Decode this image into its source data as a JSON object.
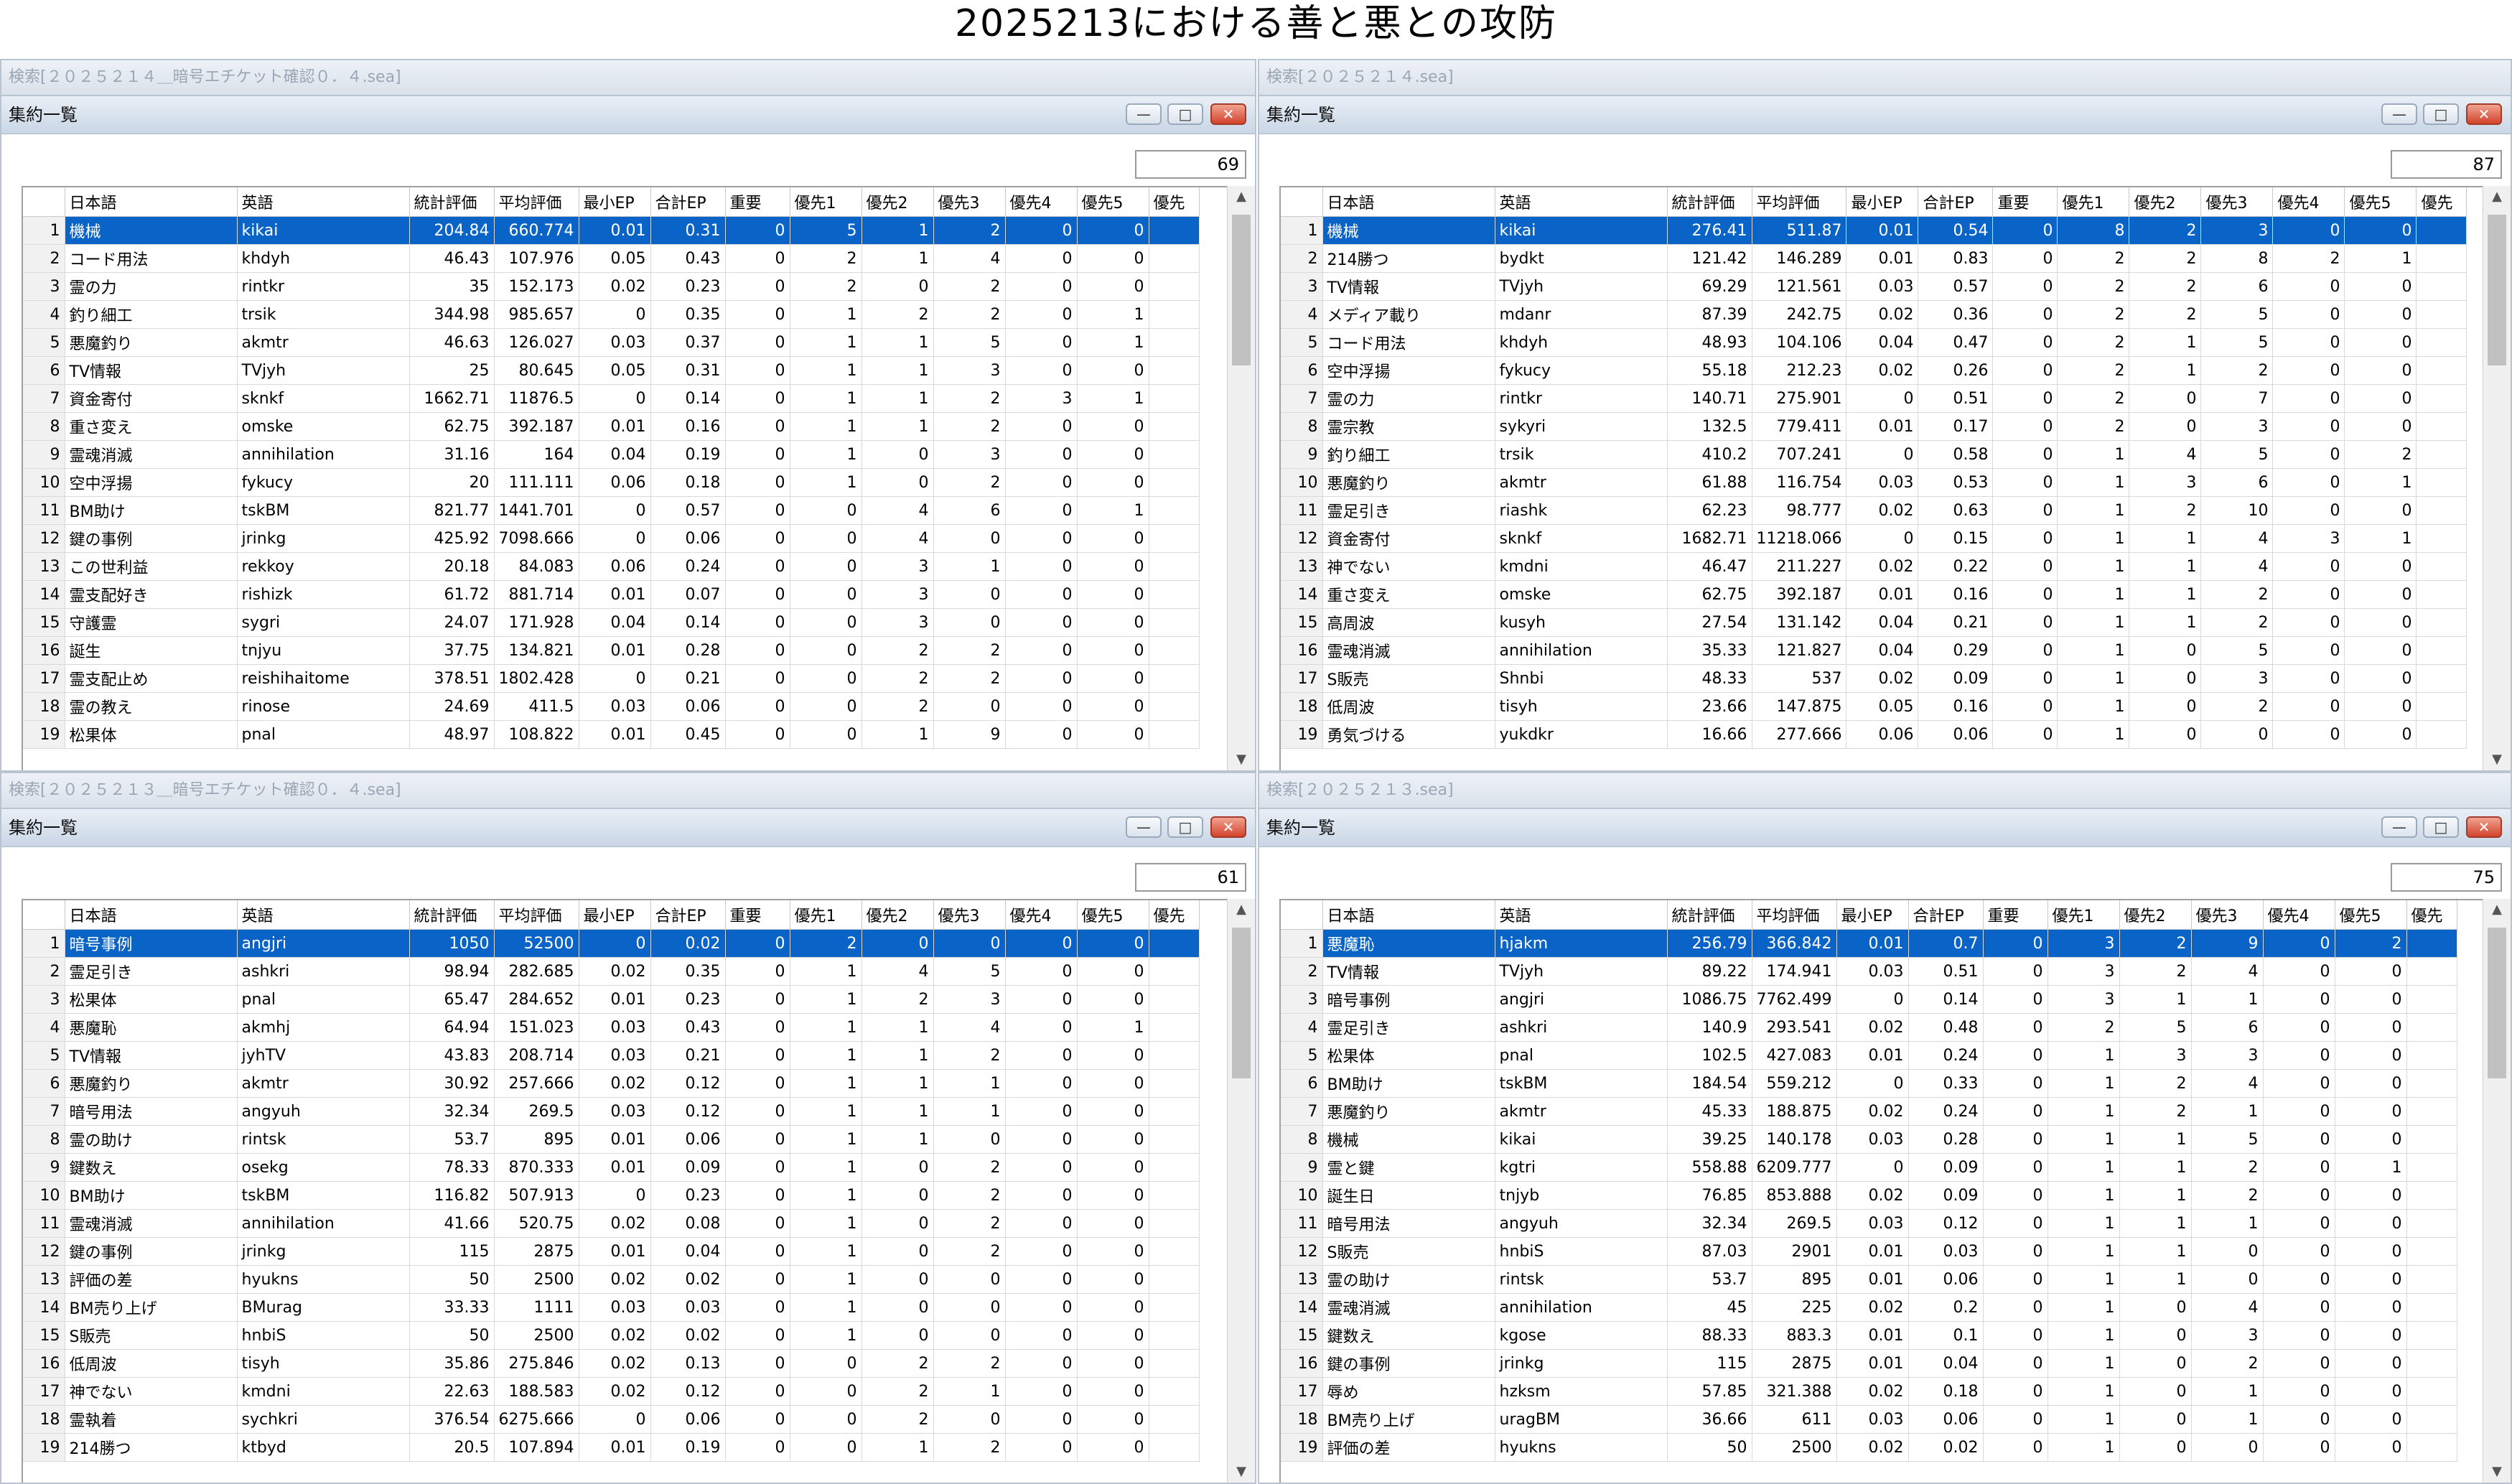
{
  "title": "2025213における善と悪との攻防",
  "columns": [
    "日本語",
    "英語",
    "統計評価",
    "平均評価",
    "最小EP",
    "合計EP",
    "重要",
    "優先1",
    "優先2",
    "優先3",
    "優先4",
    "優先5",
    "優先"
  ],
  "panes": [
    {
      "search": "検索[２０２５２１４＿暗号エチケット確認０．４.sea]",
      "window_title": "集約一覧",
      "count": "69",
      "rows": [
        [
          "1",
          "機械",
          "kikai",
          "204.84",
          "660.774",
          "0.01",
          "0.31",
          "0",
          "5",
          "1",
          "2",
          "0",
          "0"
        ],
        [
          "2",
          "コード用法",
          "khdyh",
          "46.43",
          "107.976",
          "0.05",
          "0.43",
          "0",
          "2",
          "1",
          "4",
          "0",
          "0"
        ],
        [
          "3",
          "霊の力",
          "rintkr",
          "35",
          "152.173",
          "0.02",
          "0.23",
          "0",
          "2",
          "0",
          "2",
          "0",
          "0"
        ],
        [
          "4",
          "釣り細工",
          "trsik",
          "344.98",
          "985.657",
          "0",
          "0.35",
          "0",
          "1",
          "2",
          "2",
          "0",
          "1"
        ],
        [
          "5",
          "悪魔釣り",
          "akmtr",
          "46.63",
          "126.027",
          "0.03",
          "0.37",
          "0",
          "1",
          "1",
          "5",
          "0",
          "1"
        ],
        [
          "6",
          "TV情報",
          "TVjyh",
          "25",
          "80.645",
          "0.05",
          "0.31",
          "0",
          "1",
          "1",
          "3",
          "0",
          "0"
        ],
        [
          "7",
          "資金寄付",
          "sknkf",
          "1662.71",
          "11876.5",
          "0",
          "0.14",
          "0",
          "1",
          "1",
          "2",
          "3",
          "1"
        ],
        [
          "8",
          "重さ変え",
          "omske",
          "62.75",
          "392.187",
          "0.01",
          "0.16",
          "0",
          "1",
          "1",
          "2",
          "0",
          "0"
        ],
        [
          "9",
          "霊魂消滅",
          "annihilation",
          "31.16",
          "164",
          "0.04",
          "0.19",
          "0",
          "1",
          "0",
          "3",
          "0",
          "0"
        ],
        [
          "10",
          "空中浮揚",
          "fykucy",
          "20",
          "111.111",
          "0.06",
          "0.18",
          "0",
          "1",
          "0",
          "2",
          "0",
          "0"
        ],
        [
          "11",
          "BM助け",
          "tskBM",
          "821.77",
          "1441.701",
          "0",
          "0.57",
          "0",
          "0",
          "4",
          "6",
          "0",
          "1"
        ],
        [
          "12",
          "鍵の事例",
          "jrinkg",
          "425.92",
          "7098.666",
          "0",
          "0.06",
          "0",
          "0",
          "4",
          "0",
          "0",
          "0"
        ],
        [
          "13",
          "この世利益",
          "rekkoy",
          "20.18",
          "84.083",
          "0.06",
          "0.24",
          "0",
          "0",
          "3",
          "1",
          "0",
          "0"
        ],
        [
          "14",
          "霊支配好き",
          "rishizk",
          "61.72",
          "881.714",
          "0.01",
          "0.07",
          "0",
          "0",
          "3",
          "0",
          "0",
          "0"
        ],
        [
          "15",
          "守護霊",
          "sygri",
          "24.07",
          "171.928",
          "0.04",
          "0.14",
          "0",
          "0",
          "3",
          "0",
          "0",
          "0"
        ],
        [
          "16",
          "誕生",
          "tnjyu",
          "37.75",
          "134.821",
          "0.01",
          "0.28",
          "0",
          "0",
          "2",
          "2",
          "0",
          "0"
        ],
        [
          "17",
          "霊支配止め",
          "reishihaitome",
          "378.51",
          "1802.428",
          "0",
          "0.21",
          "0",
          "0",
          "2",
          "2",
          "0",
          "0"
        ],
        [
          "18",
          "霊の教え",
          "rinose",
          "24.69",
          "411.5",
          "0.03",
          "0.06",
          "0",
          "0",
          "2",
          "0",
          "0",
          "0"
        ],
        [
          "19",
          "松果体",
          "pnal",
          "48.97",
          "108.822",
          "0.01",
          "0.45",
          "0",
          "0",
          "1",
          "9",
          "0",
          "0"
        ]
      ]
    },
    {
      "search": "検索[２０２５２１４.sea]",
      "window_title": "集約一覧",
      "count": "87",
      "rows": [
        [
          "1",
          "機械",
          "kikai",
          "276.41",
          "511.87",
          "0.01",
          "0.54",
          "0",
          "8",
          "2",
          "3",
          "0",
          "0"
        ],
        [
          "2",
          "214勝つ",
          "bydkt",
          "121.42",
          "146.289",
          "0.01",
          "0.83",
          "0",
          "2",
          "2",
          "8",
          "2",
          "1"
        ],
        [
          "3",
          "TV情報",
          "TVjyh",
          "69.29",
          "121.561",
          "0.03",
          "0.57",
          "0",
          "2",
          "2",
          "6",
          "0",
          "0"
        ],
        [
          "4",
          "メディア載り",
          "mdanr",
          "87.39",
          "242.75",
          "0.02",
          "0.36",
          "0",
          "2",
          "2",
          "5",
          "0",
          "0"
        ],
        [
          "5",
          "コード用法",
          "khdyh",
          "48.93",
          "104.106",
          "0.04",
          "0.47",
          "0",
          "2",
          "1",
          "5",
          "0",
          "0"
        ],
        [
          "6",
          "空中浮揚",
          "fykucy",
          "55.18",
          "212.23",
          "0.02",
          "0.26",
          "0",
          "2",
          "1",
          "2",
          "0",
          "0"
        ],
        [
          "7",
          "霊の力",
          "rintkr",
          "140.71",
          "275.901",
          "0",
          "0.51",
          "0",
          "2",
          "0",
          "7",
          "0",
          "0"
        ],
        [
          "8",
          "霊宗教",
          "sykyri",
          "132.5",
          "779.411",
          "0.01",
          "0.17",
          "0",
          "2",
          "0",
          "3",
          "0",
          "0"
        ],
        [
          "9",
          "釣り細工",
          "trsik",
          "410.2",
          "707.241",
          "0",
          "0.58",
          "0",
          "1",
          "4",
          "5",
          "0",
          "2"
        ],
        [
          "10",
          "悪魔釣り",
          "akmtr",
          "61.88",
          "116.754",
          "0.03",
          "0.53",
          "0",
          "1",
          "3",
          "6",
          "0",
          "1"
        ],
        [
          "11",
          "霊足引き",
          "riashk",
          "62.23",
          "98.777",
          "0.02",
          "0.63",
          "0",
          "1",
          "2",
          "10",
          "0",
          "0"
        ],
        [
          "12",
          "資金寄付",
          "sknkf",
          "1682.71",
          "11218.066",
          "0",
          "0.15",
          "0",
          "1",
          "1",
          "4",
          "3",
          "1"
        ],
        [
          "13",
          "神でない",
          "kmdni",
          "46.47",
          "211.227",
          "0.02",
          "0.22",
          "0",
          "1",
          "1",
          "4",
          "0",
          "0"
        ],
        [
          "14",
          "重さ変え",
          "omske",
          "62.75",
          "392.187",
          "0.01",
          "0.16",
          "0",
          "1",
          "1",
          "2",
          "0",
          "0"
        ],
        [
          "15",
          "高周波",
          "kusyh",
          "27.54",
          "131.142",
          "0.04",
          "0.21",
          "0",
          "1",
          "1",
          "2",
          "0",
          "0"
        ],
        [
          "16",
          "霊魂消滅",
          "annihilation",
          "35.33",
          "121.827",
          "0.04",
          "0.29",
          "0",
          "1",
          "0",
          "5",
          "0",
          "0"
        ],
        [
          "17",
          "S販売",
          "Shnbi",
          "48.33",
          "537",
          "0.02",
          "0.09",
          "0",
          "1",
          "0",
          "3",
          "0",
          "0"
        ],
        [
          "18",
          "低周波",
          "tisyh",
          "23.66",
          "147.875",
          "0.05",
          "0.16",
          "0",
          "1",
          "0",
          "2",
          "0",
          "0"
        ],
        [
          "19",
          "勇気づける",
          "yukdkr",
          "16.66",
          "277.666",
          "0.06",
          "0.06",
          "0",
          "1",
          "0",
          "0",
          "0",
          "0"
        ]
      ]
    },
    {
      "search": "検索[２０２５２１３＿暗号エチケット確認０．４.sea]",
      "window_title": "集約一覧",
      "count": "61",
      "rows": [
        [
          "1",
          "暗号事例",
          "angjri",
          "1050",
          "52500",
          "0",
          "0.02",
          "0",
          "2",
          "0",
          "0",
          "0",
          "0"
        ],
        [
          "2",
          "霊足引き",
          "ashkri",
          "98.94",
          "282.685",
          "0.02",
          "0.35",
          "0",
          "1",
          "4",
          "5",
          "0",
          "0"
        ],
        [
          "3",
          "松果体",
          "pnal",
          "65.47",
          "284.652",
          "0.01",
          "0.23",
          "0",
          "1",
          "2",
          "3",
          "0",
          "0"
        ],
        [
          "4",
          "悪魔恥",
          "akmhj",
          "64.94",
          "151.023",
          "0.03",
          "0.43",
          "0",
          "1",
          "1",
          "4",
          "0",
          "1"
        ],
        [
          "5",
          "TV情報",
          "jyhTV",
          "43.83",
          "208.714",
          "0.03",
          "0.21",
          "0",
          "1",
          "1",
          "2",
          "0",
          "0"
        ],
        [
          "6",
          "悪魔釣り",
          "akmtr",
          "30.92",
          "257.666",
          "0.02",
          "0.12",
          "0",
          "1",
          "1",
          "1",
          "0",
          "0"
        ],
        [
          "7",
          "暗号用法",
          "angyuh",
          "32.34",
          "269.5",
          "0.03",
          "0.12",
          "0",
          "1",
          "1",
          "1",
          "0",
          "0"
        ],
        [
          "8",
          "霊の助け",
          "rintsk",
          "53.7",
          "895",
          "0.01",
          "0.06",
          "0",
          "1",
          "1",
          "0",
          "0",
          "0"
        ],
        [
          "9",
          "鍵数え",
          "osekg",
          "78.33",
          "870.333",
          "0.01",
          "0.09",
          "0",
          "1",
          "0",
          "2",
          "0",
          "0"
        ],
        [
          "10",
          "BM助け",
          "tskBM",
          "116.82",
          "507.913",
          "0",
          "0.23",
          "0",
          "1",
          "0",
          "2",
          "0",
          "0"
        ],
        [
          "11",
          "霊魂消滅",
          "annihilation",
          "41.66",
          "520.75",
          "0.02",
          "0.08",
          "0",
          "1",
          "0",
          "2",
          "0",
          "0"
        ],
        [
          "12",
          "鍵の事例",
          "jrinkg",
          "115",
          "2875",
          "0.01",
          "0.04",
          "0",
          "1",
          "0",
          "2",
          "0",
          "0"
        ],
        [
          "13",
          "評価の差",
          "hyukns",
          "50",
          "2500",
          "0.02",
          "0.02",
          "0",
          "1",
          "0",
          "0",
          "0",
          "0"
        ],
        [
          "14",
          "BM売り上げ",
          "BMurag",
          "33.33",
          "1111",
          "0.03",
          "0.03",
          "0",
          "1",
          "0",
          "0",
          "0",
          "0"
        ],
        [
          "15",
          "S販売",
          "hnbiS",
          "50",
          "2500",
          "0.02",
          "0.02",
          "0",
          "1",
          "0",
          "0",
          "0",
          "0"
        ],
        [
          "16",
          "低周波",
          "tisyh",
          "35.86",
          "275.846",
          "0.02",
          "0.13",
          "0",
          "0",
          "2",
          "2",
          "0",
          "0"
        ],
        [
          "17",
          "神でない",
          "kmdni",
          "22.63",
          "188.583",
          "0.02",
          "0.12",
          "0",
          "0",
          "2",
          "1",
          "0",
          "0"
        ],
        [
          "18",
          "霊執着",
          "sychkri",
          "376.54",
          "6275.666",
          "0",
          "0.06",
          "0",
          "0",
          "2",
          "0",
          "0",
          "0"
        ],
        [
          "19",
          "214勝つ",
          "ktbyd",
          "20.5",
          "107.894",
          "0.01",
          "0.19",
          "0",
          "0",
          "1",
          "2",
          "0",
          "0"
        ]
      ]
    },
    {
      "search": "検索[２０２５２１３.sea]",
      "window_title": "集約一覧",
      "count": "75",
      "rows": [
        [
          "1",
          "悪魔恥",
          "hjakm",
          "256.79",
          "366.842",
          "0.01",
          "0.7",
          "0",
          "3",
          "2",
          "9",
          "0",
          "2"
        ],
        [
          "2",
          "TV情報",
          "TVjyh",
          "89.22",
          "174.941",
          "0.03",
          "0.51",
          "0",
          "3",
          "2",
          "4",
          "0",
          "0"
        ],
        [
          "3",
          "暗号事例",
          "angjri",
          "1086.75",
          "7762.499",
          "0",
          "0.14",
          "0",
          "3",
          "1",
          "1",
          "0",
          "0"
        ],
        [
          "4",
          "霊足引き",
          "ashkri",
          "140.9",
          "293.541",
          "0.02",
          "0.48",
          "0",
          "2",
          "5",
          "6",
          "0",
          "0"
        ],
        [
          "5",
          "松果体",
          "pnal",
          "102.5",
          "427.083",
          "0.01",
          "0.24",
          "0",
          "1",
          "3",
          "3",
          "0",
          "0"
        ],
        [
          "6",
          "BM助け",
          "tskBM",
          "184.54",
          "559.212",
          "0",
          "0.33",
          "0",
          "1",
          "2",
          "4",
          "0",
          "0"
        ],
        [
          "7",
          "悪魔釣り",
          "akmtr",
          "45.33",
          "188.875",
          "0.02",
          "0.24",
          "0",
          "1",
          "2",
          "1",
          "0",
          "0"
        ],
        [
          "8",
          "機械",
          "kikai",
          "39.25",
          "140.178",
          "0.03",
          "0.28",
          "0",
          "1",
          "1",
          "5",
          "0",
          "0"
        ],
        [
          "9",
          "霊と鍵",
          "kgtri",
          "558.88",
          "6209.777",
          "0",
          "0.09",
          "0",
          "1",
          "1",
          "2",
          "0",
          "1"
        ],
        [
          "10",
          "誕生日",
          "tnjyb",
          "76.85",
          "853.888",
          "0.02",
          "0.09",
          "0",
          "1",
          "1",
          "2",
          "0",
          "0"
        ],
        [
          "11",
          "暗号用法",
          "angyuh",
          "32.34",
          "269.5",
          "0.03",
          "0.12",
          "0",
          "1",
          "1",
          "1",
          "0",
          "0"
        ],
        [
          "12",
          "S販売",
          "hnbiS",
          "87.03",
          "2901",
          "0.01",
          "0.03",
          "0",
          "1",
          "1",
          "0",
          "0",
          "0"
        ],
        [
          "13",
          "霊の助け",
          "rintsk",
          "53.7",
          "895",
          "0.01",
          "0.06",
          "0",
          "1",
          "1",
          "0",
          "0",
          "0"
        ],
        [
          "14",
          "霊魂消滅",
          "annihilation",
          "45",
          "225",
          "0.02",
          "0.2",
          "0",
          "1",
          "0",
          "4",
          "0",
          "0"
        ],
        [
          "15",
          "鍵数え",
          "kgose",
          "88.33",
          "883.3",
          "0.01",
          "0.1",
          "0",
          "1",
          "0",
          "3",
          "0",
          "0"
        ],
        [
          "16",
          "鍵の事例",
          "jrinkg",
          "115",
          "2875",
          "0.01",
          "0.04",
          "0",
          "1",
          "0",
          "2",
          "0",
          "0"
        ],
        [
          "17",
          "辱め",
          "hzksm",
          "57.85",
          "321.388",
          "0.02",
          "0.18",
          "0",
          "1",
          "0",
          "1",
          "0",
          "0"
        ],
        [
          "18",
          "BM売り上げ",
          "uragBM",
          "36.66",
          "611",
          "0.03",
          "0.06",
          "0",
          "1",
          "0",
          "1",
          "0",
          "0"
        ],
        [
          "19",
          "評価の差",
          "hyukns",
          "50",
          "2500",
          "0.02",
          "0.02",
          "0",
          "1",
          "0",
          "0",
          "0",
          "0"
        ]
      ]
    }
  ]
}
